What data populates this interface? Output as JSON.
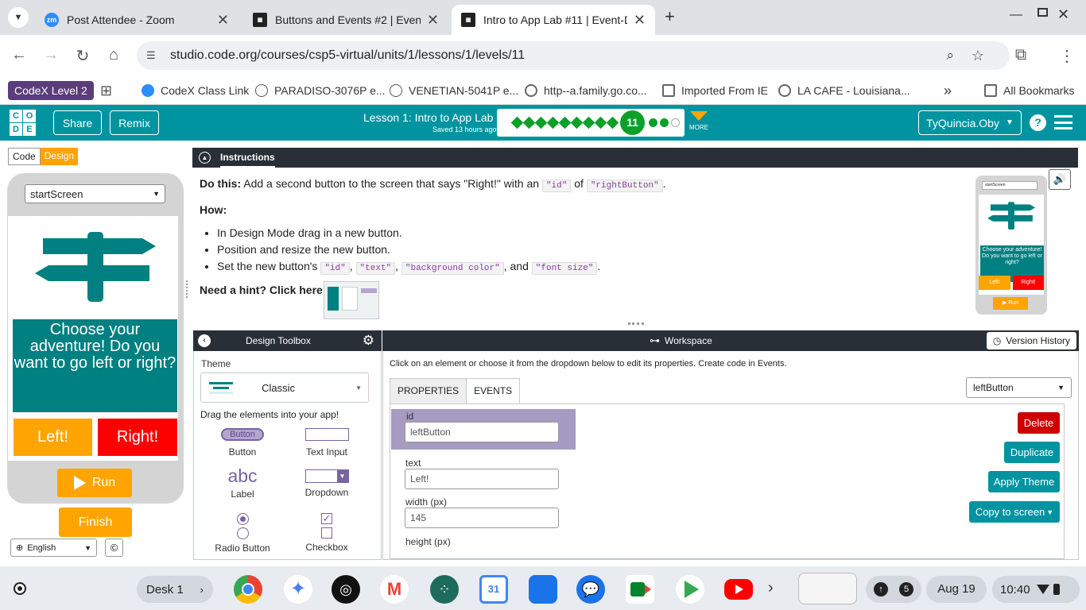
{
  "browser": {
    "tabs": [
      {
        "title": "Post Attendee - Zoom",
        "favicon": "zoom-icon",
        "active": false
      },
      {
        "title": "Buttons and Events #2 | Event-D",
        "favicon": "code-org-icon",
        "active": false
      },
      {
        "title": "Intro to App Lab #11 | Event-Dri",
        "favicon": "code-org-icon",
        "active": true
      }
    ],
    "new_tab": "+",
    "url": "studio.code.org/courses/csp5-virtual/units/1/lessons/1/levels/11",
    "bookmarks": [
      {
        "label": "CodeX Level 2",
        "icon": "profile-chip"
      },
      {
        "label": "CodeX Class Link",
        "icon": "zoom-icon"
      },
      {
        "label": "PARADISO-3076P e...",
        "icon": "venetian-icon"
      },
      {
        "label": "VENETIAN-5041P e...",
        "icon": "venetian-icon"
      },
      {
        "label": "http--a.family.go.co...",
        "icon": "globe-icon"
      },
      {
        "label": "Imported From IE",
        "icon": "folder-icon"
      },
      {
        "label": "LA CAFE - Louisiana...",
        "icon": "globe-icon"
      }
    ],
    "all_bookmarks": "All Bookmarks",
    "more_bookmarks": "»"
  },
  "header": {
    "logo_letters": [
      "C",
      "O",
      "D",
      "E"
    ],
    "share": "Share",
    "remix": "Remix",
    "lesson_title": "Lesson 1: Intro to App Lab",
    "saved": "Saved 13 hours ago",
    "current_level": "11",
    "more": "MORE",
    "user": "TyQuincia.Oby",
    "help": "?",
    "colors": {
      "header_bg": "#0094a1",
      "progress_done": "#0ca028"
    }
  },
  "left_panel": {
    "code_tab": "Code",
    "design_tab": "Design",
    "screen_select": "startScreen",
    "app_text": "Choose your adventure! Do you want to go left or right?",
    "left_button": "Left!",
    "right_button": "Right!",
    "run": "Run",
    "finish": "Finish",
    "language": "English",
    "copyright": "©"
  },
  "instructions": {
    "tab_label": "Instructions",
    "do_this_label": "Do this:",
    "do_this_text_a": " Add a second button to the screen that says \"Right!\" with an ",
    "code_id": "\"id\"",
    "of_text": " of ",
    "code_rightbutton": "\"rightButton\"",
    "period": ".",
    "how_label": "How:",
    "steps": [
      "In Design Mode drag in a new button.",
      "Position and resize the new button.",
      "Set the new button's "
    ],
    "code_props": [
      "\"id\"",
      "\"text\"",
      "\"background color\"",
      "\"font size\""
    ],
    "and_text": ", and ",
    "hint": "Need a hint? Click here:",
    "thumb": {
      "screen": "startScreen",
      "text": "Choose your adventure! Do you want to go left or right?",
      "left": "Left!",
      "right": "Right!",
      "run": "Run"
    }
  },
  "toolbox": {
    "title": "Design Toolbox",
    "theme_label": "Theme",
    "theme_value": "Classic",
    "drag_text": "Drag the elements into your app!",
    "items": [
      {
        "label": "Button",
        "preview": "Button"
      },
      {
        "label": "Text Input"
      },
      {
        "label": "Label",
        "preview": "abc"
      },
      {
        "label": "Dropdown"
      },
      {
        "label": "Radio Button"
      },
      {
        "label": "Checkbox"
      }
    ]
  },
  "workspace": {
    "title": "Workspace",
    "version_history": "Version History",
    "hint": "Click on an element or choose it from the dropdown below to edit its properties. Create code in Events.",
    "tabs": [
      "PROPERTIES",
      "EVENTS"
    ],
    "element_select": "leftButton",
    "properties": [
      {
        "label": "id",
        "value": "leftButton"
      },
      {
        "label": "text",
        "value": "Left!"
      },
      {
        "label": "width (px)",
        "value": "145"
      },
      {
        "label": "height (px)",
        "value": ""
      }
    ],
    "actions": {
      "delete": "Delete",
      "duplicate": "Duplicate",
      "apply_theme": "Apply Theme",
      "copy_to_screen": "Copy to screen"
    }
  },
  "shelf": {
    "desk": "Desk 1",
    "apps": [
      "chrome",
      "gemini",
      "wifi-app",
      "gmail",
      "slack",
      "calendar",
      "files",
      "messages",
      "meet",
      "play-store",
      "youtube"
    ],
    "calendar_day": "31",
    "notifications": "5",
    "date": "Aug 19",
    "time": "10:40"
  }
}
